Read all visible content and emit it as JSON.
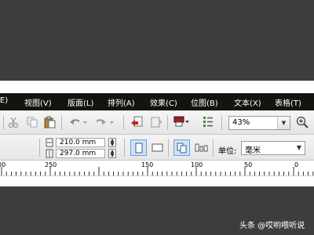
{
  "menubar": {
    "items": [
      {
        "label": "(E)"
      },
      {
        "label": "视图(V)"
      },
      {
        "label": "版面(L)"
      },
      {
        "label": "排列(A)"
      },
      {
        "label": "效果(C)"
      },
      {
        "label": "位图(B)"
      },
      {
        "label": "文本(X)"
      },
      {
        "label": "表格(T)"
      }
    ]
  },
  "toolbar": {
    "zoom_value": "43%",
    "icons": [
      "cut-icon",
      "copy-icon",
      "paste-icon",
      "undo-icon",
      "redo-icon",
      "import-icon",
      "export-icon",
      "publish-pdf-icon",
      "application-launcher-icon",
      "zoom-in-icon"
    ]
  },
  "property_bar": {
    "width_value": "210.0 mm",
    "height_value": "297.0 mm",
    "unit_label": "单位:",
    "unit_value": "毫米"
  },
  "ruler": {
    "labels": [
      "00",
      "250",
      "150",
      "100",
      "50",
      "0"
    ]
  },
  "watermark": "头条 @哎哟喂听说"
}
